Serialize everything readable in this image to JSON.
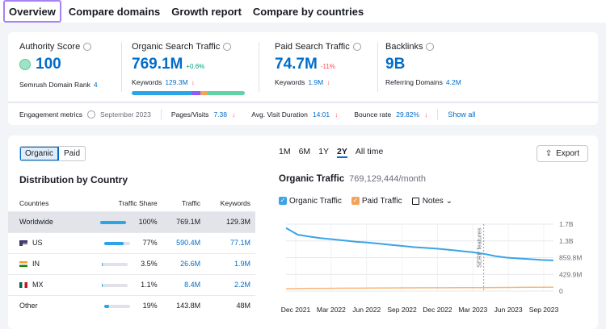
{
  "tabs": [
    "Overview",
    "Compare domains",
    "Growth report",
    "Compare by countries"
  ],
  "metrics": {
    "authority": {
      "title": "Authority Score",
      "value": "100",
      "sub_label": "Semrush Domain Rank",
      "sub_value": "4"
    },
    "organic": {
      "title": "Organic Search Traffic",
      "value": "769.1M",
      "delta": "+0.6%",
      "sub_label": "Keywords",
      "sub_value": "129.3M"
    },
    "paid": {
      "title": "Paid Search Traffic",
      "value": "74.7M",
      "delta": "-11%",
      "sub_label": "Keywords",
      "sub_value": "1.9M"
    },
    "backlinks": {
      "title": "Backlinks",
      "value": "9B",
      "sub_label": "Referring Domains",
      "sub_value": "4.2M"
    }
  },
  "engagement": {
    "label": "Engagement metrics",
    "date": "September 2023",
    "pages_label": "Pages/Visits",
    "pages_value": "7.38",
    "duration_label": "Avg. Visit Duration",
    "duration_value": "14:01",
    "bounce_label": "Bounce rate",
    "bounce_value": "29.82%",
    "show_all": "Show all"
  },
  "toggle": {
    "organic": "Organic",
    "paid": "Paid"
  },
  "distribution": {
    "title": "Distribution by Country",
    "headers": [
      "Countries",
      "Traffic Share",
      "Traffic",
      "Keywords"
    ],
    "rows": [
      {
        "country": "Worldwide",
        "share": "100%",
        "share_frac": 1.0,
        "traffic": "769.1M",
        "keywords": "129.3M"
      },
      {
        "country": "US",
        "share": "77%",
        "share_frac": 0.77,
        "traffic": "590.4M",
        "keywords": "77.1M"
      },
      {
        "country": "IN",
        "share": "3.5%",
        "share_frac": 0.035,
        "traffic": "26.6M",
        "keywords": "1.9M"
      },
      {
        "country": "MX",
        "share": "1.1%",
        "share_frac": 0.011,
        "traffic": "8.4M",
        "keywords": "2.2M"
      },
      {
        "country": "Other",
        "share": "19%",
        "share_frac": 0.19,
        "traffic": "143.8M",
        "keywords": "48M"
      }
    ]
  },
  "periods": [
    "1M",
    "6M",
    "1Y",
    "2Y",
    "All time"
  ],
  "active_period": "2Y",
  "export_label": "Export",
  "organic_traffic": {
    "title": "Organic Traffic",
    "subtitle": "769,129,444/month"
  },
  "legend": {
    "organic": "Organic Traffic",
    "paid": "Paid Traffic",
    "notes": "Notes"
  },
  "colors": {
    "organic": "#3aa4e5",
    "paid": "#f8b77a",
    "accent": "#006dca",
    "highlight": "#a881f7"
  },
  "chart_data": {
    "type": "line",
    "x": [
      "2021-10",
      "2021-11",
      "2021-12",
      "2022-01",
      "2022-02",
      "2022-03",
      "2022-04",
      "2022-05",
      "2022-06",
      "2022-07",
      "2022-08",
      "2022-09",
      "2022-10",
      "2022-11",
      "2022-12",
      "2023-01",
      "2023-02",
      "2023-03",
      "2023-04",
      "2023-05",
      "2023-06",
      "2023-07",
      "2023-08",
      "2023-09"
    ],
    "x_ticks": [
      "Dec 2021",
      "Mar 2022",
      "Jun 2022",
      "Sep 2022",
      "Dec 2022",
      "Mar 2023",
      "Jun 2023",
      "Sep 2023"
    ],
    "y_ticks": [
      "1.7B",
      "1.3B",
      "859.8M",
      "429.9M",
      "0"
    ],
    "ylim": [
      0,
      1719600000
    ],
    "series": [
      {
        "name": "Organic Traffic",
        "values": [
          1620000000,
          1450000000,
          1400000000,
          1360000000,
          1330000000,
          1300000000,
          1270000000,
          1250000000,
          1220000000,
          1190000000,
          1160000000,
          1130000000,
          1110000000,
          1090000000,
          1060000000,
          1030000000,
          1000000000,
          960000000,
          900000000,
          860000000,
          840000000,
          820000000,
          800000000,
          790000000
        ]
      },
      {
        "name": "Paid Traffic",
        "values": [
          60000000,
          65000000,
          70000000,
          70000000,
          72000000,
          75000000,
          75000000,
          78000000,
          80000000,
          80000000,
          82000000,
          82000000,
          84000000,
          85000000,
          85000000,
          86000000,
          88000000,
          90000000,
          92000000,
          94000000,
          96000000,
          98000000,
          100000000,
          102000000
        ]
      }
    ],
    "annotation": {
      "label": "SERP features",
      "x": "2023-03"
    }
  }
}
